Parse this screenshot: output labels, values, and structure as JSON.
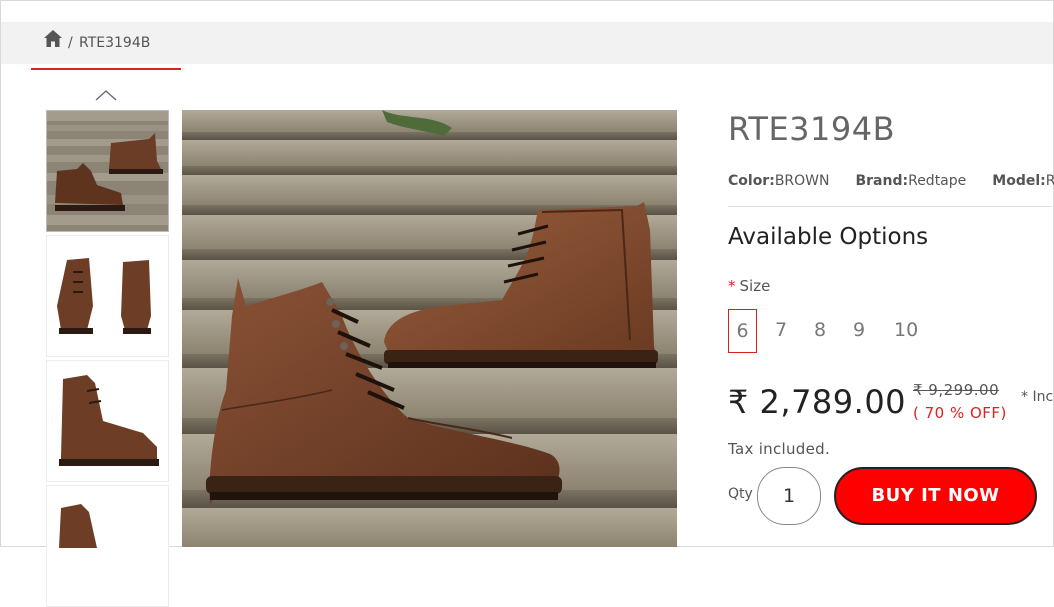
{
  "breadcrumb": {
    "home_icon": "home-icon",
    "separator": "/",
    "current": "RTE3194B"
  },
  "gallery": {
    "up_icon": "chevron-up-icon",
    "thumbnails": [
      "thumbnail-1",
      "thumbnail-2",
      "thumbnail-3",
      "thumbnail-4"
    ]
  },
  "product": {
    "title": "RTE3194B",
    "meta": {
      "color_label": "Color:",
      "color_value": "BROWN",
      "brand_label": "Brand:",
      "brand_value": "Redtape",
      "model_label": "Model:",
      "model_value": "R"
    },
    "options_heading": "Available Options",
    "size_required": "*",
    "size_label": "Size",
    "sizes": [
      "6",
      "7",
      "8",
      "9",
      "10"
    ],
    "selected_size": "6",
    "price": "₹ 2,789.00",
    "old_price": "₹ 9,299.00",
    "discount": "( 70 % OFF)",
    "incl_text": "* Inc",
    "tax_note": "Tax included.",
    "qty_label": "Qty",
    "qty_value": "1",
    "buy_label": "BUY IT NOW"
  },
  "colors": {
    "accent": "#ff0000",
    "discount": "#e02020",
    "underline": "#e02020",
    "leather": "#6e3d26",
    "steps": "#8a8272"
  }
}
